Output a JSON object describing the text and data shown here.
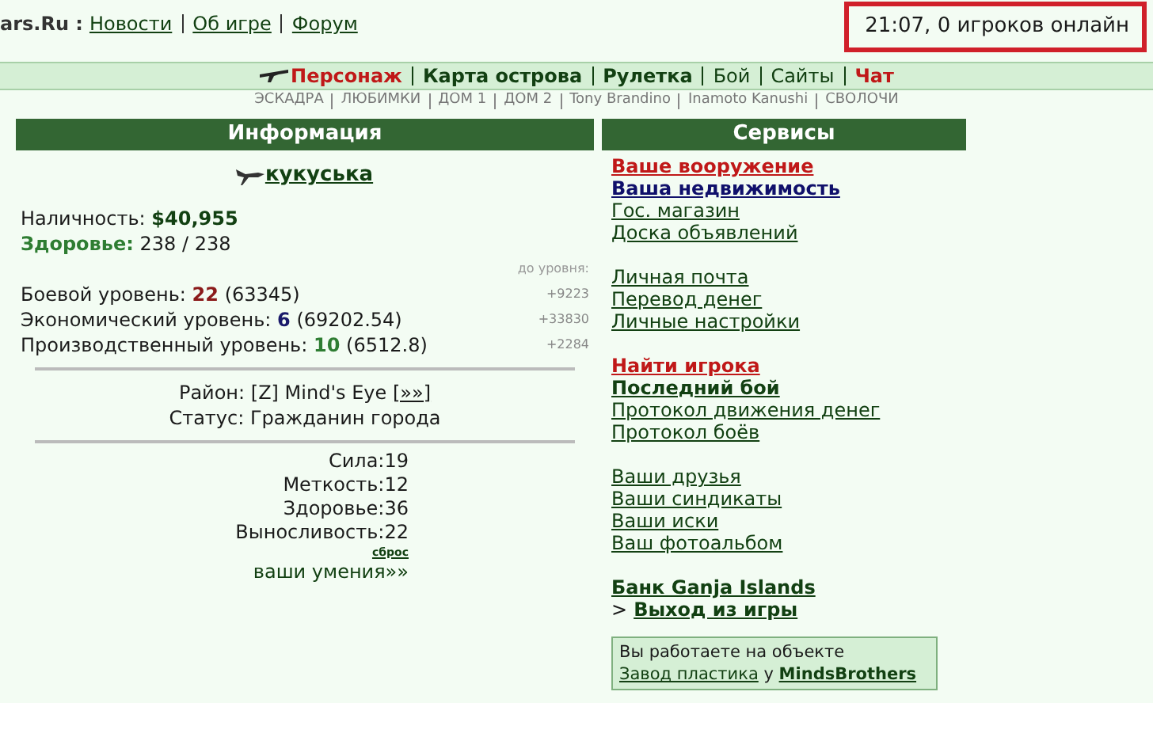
{
  "header": {
    "site": "ars.Ru :",
    "links": [
      "Новости",
      "Об игре",
      "Форум"
    ],
    "status": "21:07, 0 игроков онлайн"
  },
  "nav": [
    {
      "label": "Персонаж",
      "kind": "alert"
    },
    {
      "label": "Карта острова",
      "kind": "strong"
    },
    {
      "label": "Рулетка",
      "kind": "strong"
    },
    {
      "label": "Бой",
      "kind": "plain"
    },
    {
      "label": "Сайты",
      "kind": "plain"
    },
    {
      "label": "Чат",
      "kind": "alert"
    }
  ],
  "subnav": [
    "ЭСКАДРА",
    "ЛЮБИМКИ",
    "ДОМ 1",
    "ДОМ 2",
    "Tony Brandino",
    "Inamoto Kanushi",
    "СВОЛОЧИ"
  ],
  "info": {
    "title": "Информация",
    "player": "кукуська",
    "cash_label": "Наличность:",
    "cash": "$40,955",
    "health_label": "Здоровье:",
    "health": "238 / 238",
    "to_level": "до уровня:",
    "levels": [
      {
        "label": "Боевой уровень:",
        "value": "22",
        "points": "(63345)",
        "remaining": "+9223",
        "color": "#8b1a1a"
      },
      {
        "label": "Экономический уровень:",
        "value": "6",
        "points": "(69202.54)",
        "remaining": "+33830",
        "color": "#1a1a6b"
      },
      {
        "label": "Производственный уровень:",
        "value": "10",
        "points": "(6512.8)",
        "remaining": "+2284",
        "color": "#2e7d32"
      }
    ],
    "district_label": "Район:",
    "district": "[Z] Mind's Eye",
    "district_link": "[»»]",
    "status": "Статус: Гражданин города",
    "attributes": [
      {
        "label": "Сила:",
        "value": "19"
      },
      {
        "label": "Меткость:",
        "value": "12"
      },
      {
        "label": "Здоровье:",
        "value": "36"
      },
      {
        "label": "Выносливость:",
        "value": "22"
      }
    ],
    "reset": "сброс",
    "skills": "ваши умения»»"
  },
  "services": {
    "title": "Сервисы",
    "groups": [
      [
        {
          "label": "Ваше вооружение",
          "kind": "alert"
        },
        {
          "label": "Ваша недвижимость",
          "kind": "accent"
        },
        {
          "label": "Гос. магазин",
          "kind": "plain"
        },
        {
          "label": "Доска объявлений",
          "kind": "plain"
        }
      ],
      [
        {
          "label": "Личная почта",
          "kind": "plain"
        },
        {
          "label": "Перевод денег",
          "kind": "plain"
        },
        {
          "label": "Личные настройки",
          "kind": "plain"
        }
      ],
      [
        {
          "label": "Найти игрока",
          "kind": "alert"
        },
        {
          "label": "Последний бой",
          "kind": "strong"
        },
        {
          "label": "Протокол движения денег",
          "kind": "plain"
        },
        {
          "label": "Протокол боёв",
          "kind": "plain"
        }
      ],
      [
        {
          "label": "Ваши друзья",
          "kind": "plain"
        },
        {
          "label": "Ваши синдикаты",
          "kind": "plain"
        },
        {
          "label": "Ваши иски",
          "kind": "plain"
        },
        {
          "label": "Ваш фотоальбом",
          "kind": "plain"
        }
      ]
    ],
    "bank": "Банк Ganja Islands",
    "exit_prefix": ">",
    "exit": "Выход из игры",
    "work": {
      "text": "Вы работаете на объекте",
      "object": "Завод пластика",
      "at": "у",
      "owner": "MindsBrothers"
    }
  }
}
